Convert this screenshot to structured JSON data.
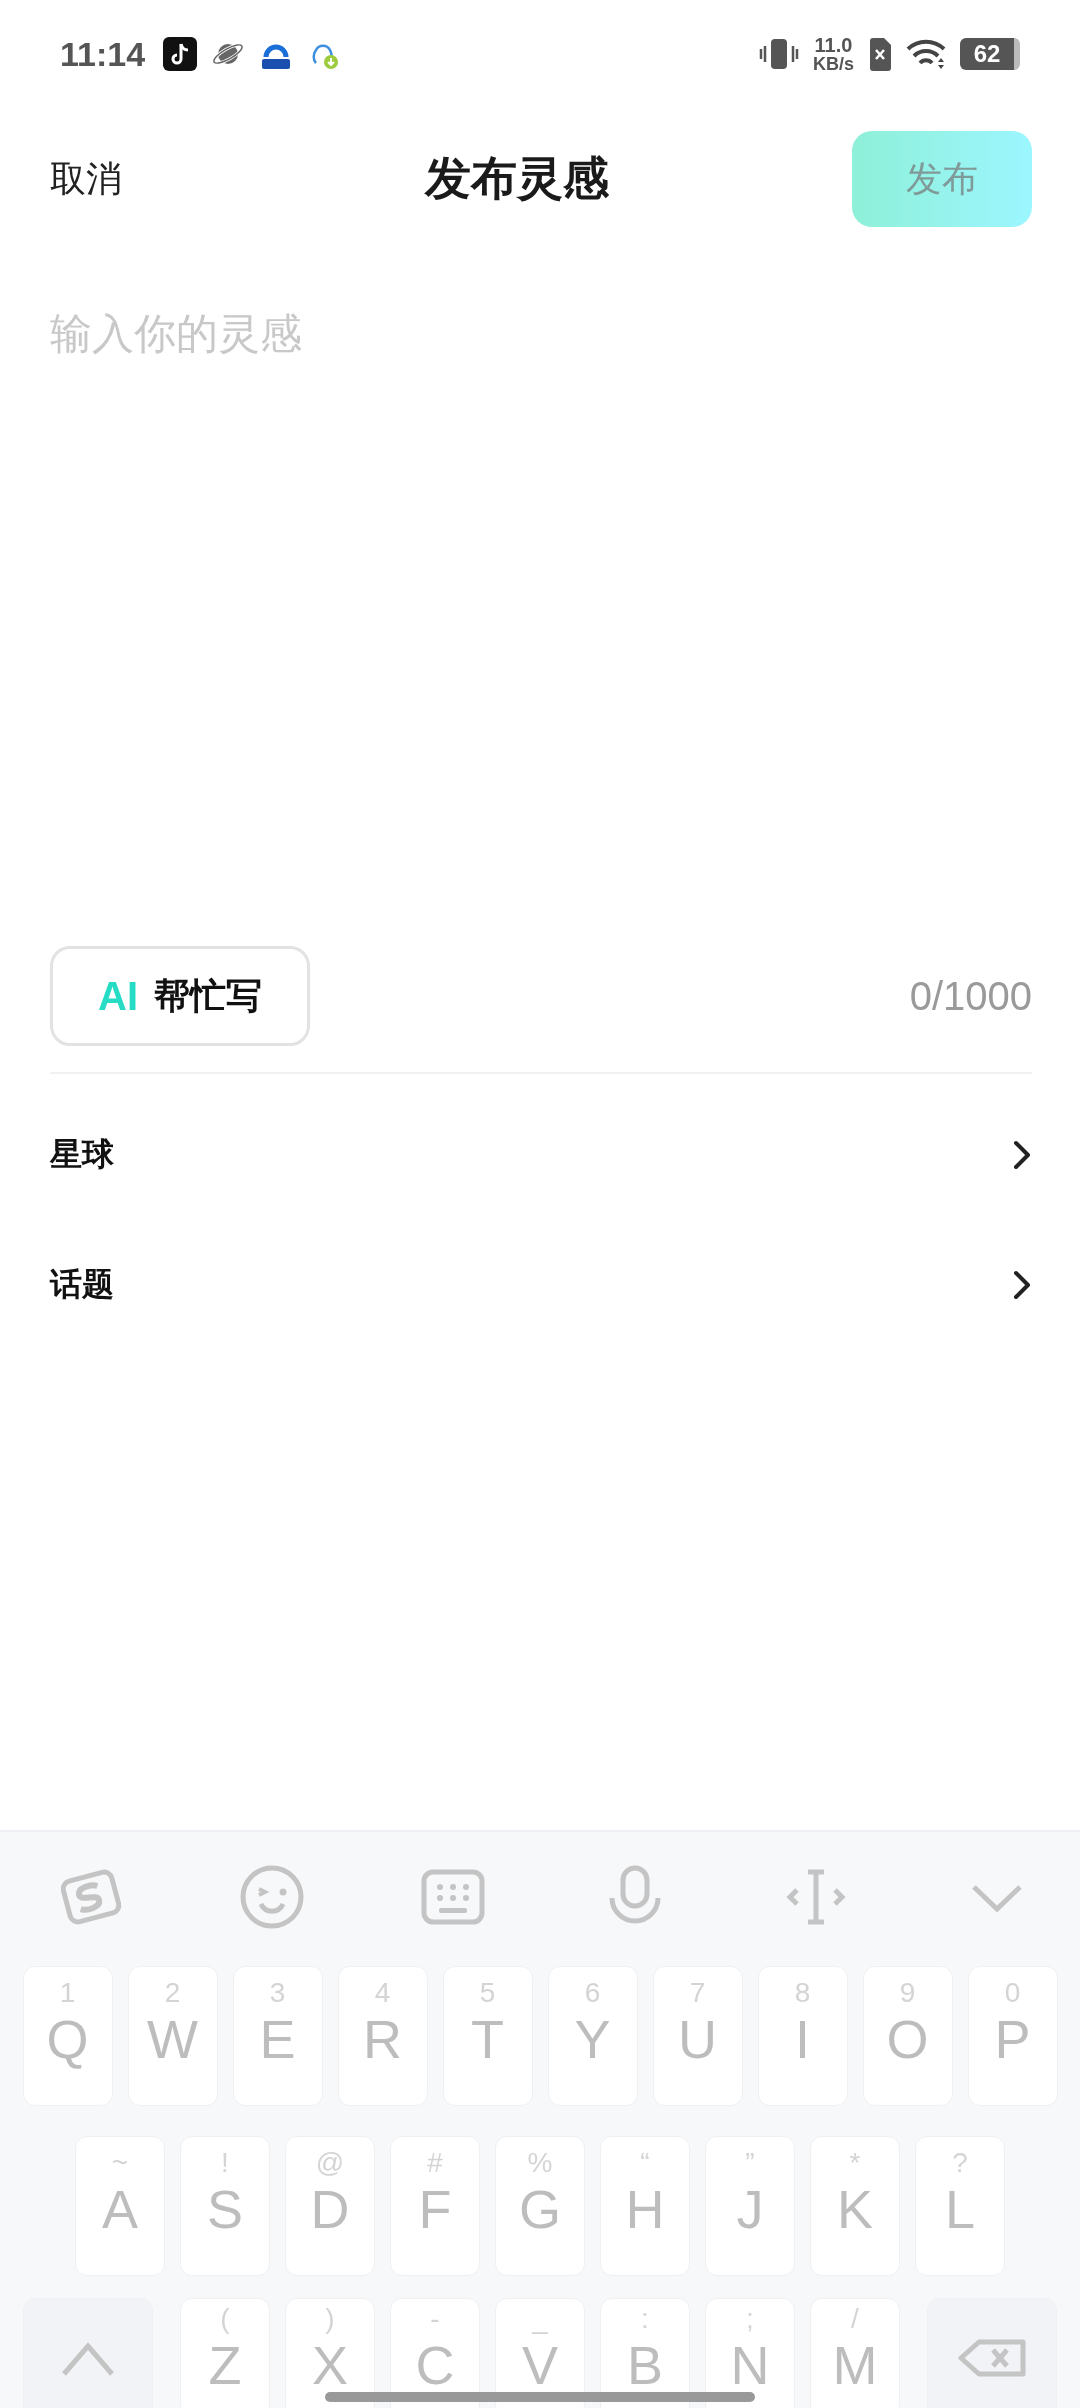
{
  "status_bar": {
    "time": "11:14",
    "speed_value": "11.0",
    "speed_unit": "KB/s",
    "battery": "62"
  },
  "header": {
    "cancel": "取消",
    "title": "发布灵感",
    "publish": {
      "label": "发布",
      "disabled": true
    }
  },
  "editor": {
    "placeholder": "输入你的灵感",
    "ai_button": {
      "badge": "AI",
      "label": "帮忙写"
    },
    "counter": "0/1000"
  },
  "rows": [
    {
      "label": "星球"
    },
    {
      "label": "话题"
    }
  ],
  "keyboard": {
    "rows": [
      [
        {
          "kind": "letter",
          "hint": "1",
          "letter": "Q"
        },
        {
          "kind": "letter",
          "hint": "2",
          "letter": "W"
        },
        {
          "kind": "letter",
          "hint": "3",
          "letter": "E"
        },
        {
          "kind": "letter",
          "hint": "4",
          "letter": "R"
        },
        {
          "kind": "letter",
          "hint": "5",
          "letter": "T"
        },
        {
          "kind": "letter",
          "hint": "6",
          "letter": "Y"
        },
        {
          "kind": "letter",
          "hint": "7",
          "letter": "U"
        },
        {
          "kind": "letter",
          "hint": "8",
          "letter": "I"
        },
        {
          "kind": "letter",
          "hint": "9",
          "letter": "O"
        },
        {
          "kind": "letter",
          "hint": "0",
          "letter": "P"
        }
      ],
      [
        {
          "kind": "letter",
          "hint": "~",
          "letter": "A"
        },
        {
          "kind": "letter",
          "hint": "!",
          "letter": "S"
        },
        {
          "kind": "letter",
          "hint": "@",
          "letter": "D"
        },
        {
          "kind": "letter",
          "hint": "#",
          "letter": "F"
        },
        {
          "kind": "letter",
          "hint": "%",
          "letter": "G"
        },
        {
          "kind": "letter",
          "hint": "“",
          "letter": "H"
        },
        {
          "kind": "letter",
          "hint": "”",
          "letter": "J"
        },
        {
          "kind": "letter",
          "hint": "*",
          "letter": "K"
        },
        {
          "kind": "letter",
          "hint": "?",
          "letter": "L"
        }
      ],
      [
        {
          "kind": "shift"
        },
        {
          "kind": "letter",
          "hint": "(",
          "letter": "Z"
        },
        {
          "kind": "letter",
          "hint": ")",
          "letter": "X"
        },
        {
          "kind": "letter",
          "hint": "-",
          "letter": "C"
        },
        {
          "kind": "letter",
          "hint": "_",
          "letter": "V"
        },
        {
          "kind": "letter",
          "hint": ":",
          "letter": "B"
        },
        {
          "kind": "letter",
          "hint": ";",
          "letter": "N"
        },
        {
          "kind": "letter",
          "hint": "/",
          "letter": "M"
        },
        {
          "kind": "backspace"
        }
      ]
    ]
  }
}
